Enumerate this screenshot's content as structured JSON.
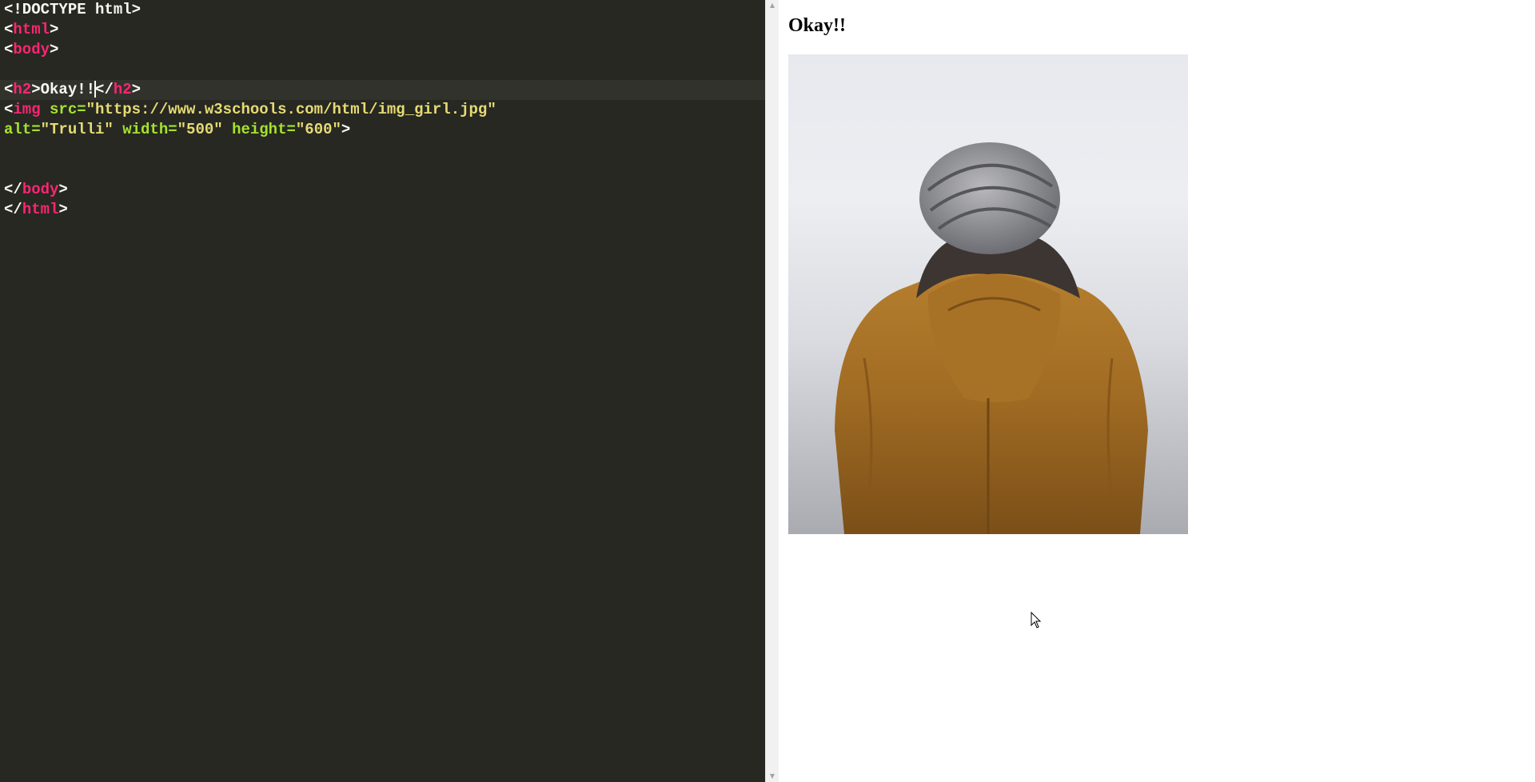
{
  "editor": {
    "lines": [
      [
        {
          "t": "<!DOCTYPE html>",
          "c": "punct"
        }
      ],
      [
        {
          "t": "<",
          "c": "punct"
        },
        {
          "t": "html",
          "c": "tag"
        },
        {
          "t": ">",
          "c": "punct"
        }
      ],
      [
        {
          "t": "<",
          "c": "punct"
        },
        {
          "t": "body",
          "c": "tag"
        },
        {
          "t": ">",
          "c": "punct"
        }
      ],
      [],
      [
        {
          "t": "<",
          "c": "punct"
        },
        {
          "t": "h2",
          "c": "tag"
        },
        {
          "t": ">",
          "c": "punct"
        },
        {
          "t": "Okay!!",
          "c": "text"
        },
        {
          "caret": true
        },
        {
          "t": "</",
          "c": "punct"
        },
        {
          "t": "h2",
          "c": "tag"
        },
        {
          "t": ">",
          "c": "punct"
        }
      ],
      [
        {
          "t": "<",
          "c": "punct"
        },
        {
          "t": "img",
          "c": "tag"
        },
        {
          "t": " src=",
          "c": "attr"
        },
        {
          "t": "\"https://www.w3schools.com/html/img_girl.jpg\"",
          "c": "str"
        }
      ],
      [
        {
          "t": "alt=",
          "c": "attr"
        },
        {
          "t": "\"Trulli\"",
          "c": "str"
        },
        {
          "t": " width=",
          "c": "attr"
        },
        {
          "t": "\"500\"",
          "c": "str"
        },
        {
          "t": " height=",
          "c": "attr"
        },
        {
          "t": "\"600\"",
          "c": "str"
        },
        {
          "t": ">",
          "c": "punct"
        }
      ],
      [],
      [],
      [
        {
          "t": "</",
          "c": "punct"
        },
        {
          "t": "body",
          "c": "tag"
        },
        {
          "t": ">",
          "c": "punct"
        }
      ],
      [
        {
          "t": "</",
          "c": "punct"
        },
        {
          "t": "html",
          "c": "tag"
        },
        {
          "t": ">",
          "c": "punct"
        }
      ]
    ],
    "active_line": 4
  },
  "preview": {
    "heading": "Okay!!",
    "image": {
      "alt": "Trulli",
      "width": "500",
      "height": "600"
    }
  },
  "colors": {
    "editor_bg": "#272822",
    "tag": "#f92672",
    "attr": "#a6e22e",
    "string": "#e6db74",
    "text": "#f8f8f2"
  },
  "icons": {
    "scroll_up": "triangle-up-icon",
    "scroll_down": "triangle-down-icon",
    "cursor": "mouse-pointer-icon"
  }
}
